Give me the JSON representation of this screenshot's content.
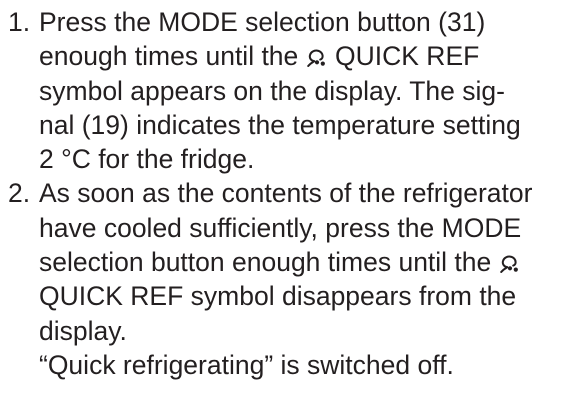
{
  "instructions": {
    "steps": [
      {
        "number": "1.",
        "lines": [
          "Press the MODE selection button (31)",
          {
            "before": "enough times until the ",
            "after": " QUICK REF"
          },
          "symbol appears on the display. The sig-",
          "nal (19) indicates the temperature setting",
          "2 °C for the fridge."
        ]
      },
      {
        "number": "2.",
        "lines": [
          "As soon as the contents of the refrigerator",
          "have cooled sufficiently, press the MODE",
          {
            "before": "selection button enough times until the ",
            "after": ""
          },
          "QUICK REF symbol disappears from the",
          "display.",
          "“Quick refrigerating” is switched off."
        ]
      }
    ],
    "icon": "quick-ref-icon"
  }
}
